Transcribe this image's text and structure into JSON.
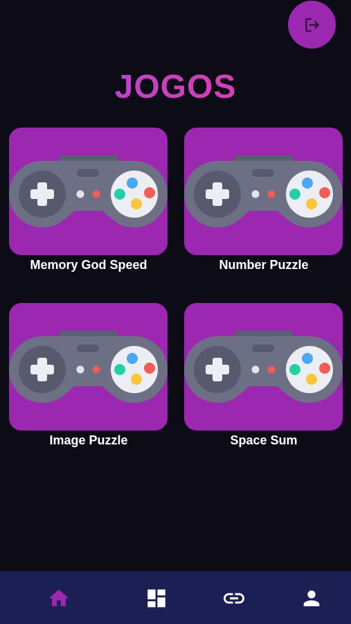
{
  "header": {
    "title": "JOGOS",
    "logout_icon": "logout-icon"
  },
  "games": [
    {
      "label": "Memory God Speed",
      "icon": "gamepad-icon"
    },
    {
      "label": "Number Puzzle",
      "icon": "gamepad-icon"
    },
    {
      "label": "Image Puzzle",
      "icon": "gamepad-icon"
    },
    {
      "label": "Space Sum",
      "icon": "gamepad-icon"
    }
  ],
  "bottom_nav": {
    "items": [
      {
        "icon": "home-icon",
        "active": true
      },
      {
        "icon": "dashboard-icon",
        "active": false
      },
      {
        "icon": "link-icon",
        "active": false
      },
      {
        "icon": "person-icon",
        "active": false
      }
    ]
  },
  "colors": {
    "background": "#0d0b16",
    "accent": "#9c27b0",
    "nav_background": "#1c1f54",
    "nav_active": "#9c27b0",
    "nav_inactive": "#ffffff",
    "title_gradient_start": "#9d4bdf",
    "title_gradient_end": "#e5479f"
  }
}
